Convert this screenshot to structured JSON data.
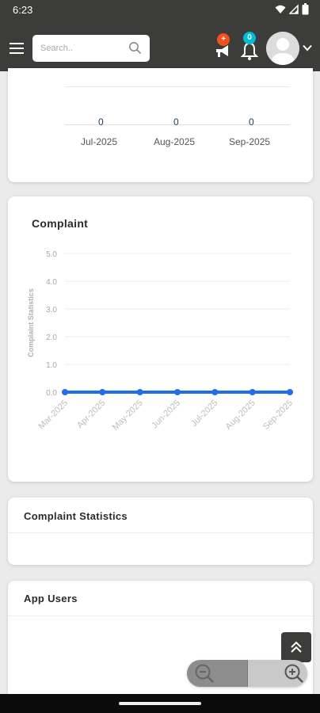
{
  "status_bar": {
    "time": "6:23"
  },
  "header": {
    "search_placeholder": "Search..",
    "notification_badge": "+",
    "bell_badge": "0"
  },
  "top_chart": {
    "values": [
      "0",
      "0",
      "0"
    ],
    "months": [
      "Jul-2025",
      "Aug-2025",
      "Sep-2025"
    ]
  },
  "complaint_chart": {
    "title": "Complaint",
    "chart_data": {
      "type": "line",
      "title": "Complaint",
      "ylabel": "Complaint Statistics",
      "xlabel": "",
      "categories": [
        "Mar-2025",
        "Apr-2025",
        "May-2025",
        "Jun-2025",
        "Jul-2025",
        "Aug-2025",
        "Sep-2025"
      ],
      "series": [
        {
          "values": [
            0,
            0,
            0,
            0,
            0,
            0,
            0
          ]
        }
      ],
      "y_ticks": [
        "5.0",
        "4.0",
        "3.0",
        "2.0",
        "1.0",
        "0.0"
      ],
      "ylim": [
        0,
        5
      ],
      "grid": true,
      "line_color": "#1f6fe8"
    }
  },
  "complaint_statistics": {
    "title": "Complaint Statistics"
  },
  "app_users": {
    "title": "App Users"
  },
  "colors": {
    "header": "#3c3c3a",
    "badge_red": "#f4511e",
    "badge_cyan": "#00bcd4",
    "accent_blue": "#1f6fe8"
  }
}
